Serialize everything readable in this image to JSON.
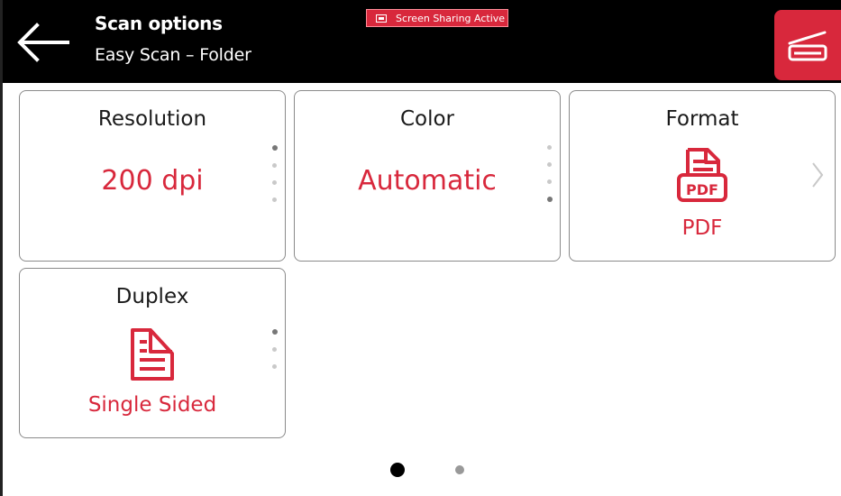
{
  "header": {
    "title": "Scan options",
    "subtitle": "Easy Scan – Folder",
    "screen_sharing_badge": "Screen Sharing Active",
    "back_icon": "arrow-left-icon",
    "scan_icon": "scanner-icon"
  },
  "tiles": {
    "resolution": {
      "label": "Resolution",
      "value": "200 dpi"
    },
    "color": {
      "label": "Color",
      "value": "Automatic"
    },
    "format": {
      "label": "Format",
      "icon": "pdf-file-icon",
      "icon_text": "PDF",
      "value": "PDF"
    },
    "duplex": {
      "label": "Duplex",
      "icon": "single-sided-document-icon",
      "value": "Single Sided"
    }
  },
  "pager": {
    "pages": 2,
    "current": 1
  },
  "colors": {
    "accent": "#d8283c",
    "header_bg": "#000000",
    "tile_border": "#8a8a8a"
  }
}
